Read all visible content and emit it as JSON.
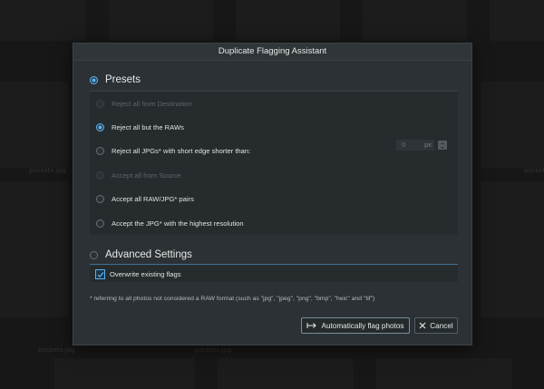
{
  "background": {
    "thumb_labels": [
      "pocketx.jpg",
      "pocketx.jpg",
      "pocketx.jpg",
      "pocketx.jpg"
    ]
  },
  "dialog": {
    "title": "Duplicate Flagging Assistant",
    "presets": {
      "label": "Presets",
      "options": [
        {
          "label": "Reject all from Destination",
          "state": "disabled"
        },
        {
          "label": "Reject all but the RAWs",
          "state": "selected"
        },
        {
          "label": "Reject all JPGs* with short edge shorter than:",
          "state": "normal"
        },
        {
          "label": "Accept all from Source",
          "state": "disabled"
        },
        {
          "label": "Accept all RAW/JPG* pairs",
          "state": "normal"
        },
        {
          "label": "Accept the JPG* with the highest resolution",
          "state": "normal"
        }
      ],
      "px_value": "0",
      "px_unit": "px"
    },
    "advanced": {
      "label": "Advanced Settings",
      "overwrite_label": "Overwrite existing flags",
      "overwrite_checked": true
    },
    "footnote": "* referring to all photos not considered a RAW format (such as \"jpg\", \"jpeg\", \"png\", \"bmp\", \"heic\" and \"tif\")",
    "buttons": {
      "auto_flag": "Automatically flag photos",
      "cancel": "Cancel"
    }
  },
  "colors": {
    "accent": "#57b4f5",
    "dialog_bg": "#2b3134",
    "panel_bg": "#262b2e"
  }
}
